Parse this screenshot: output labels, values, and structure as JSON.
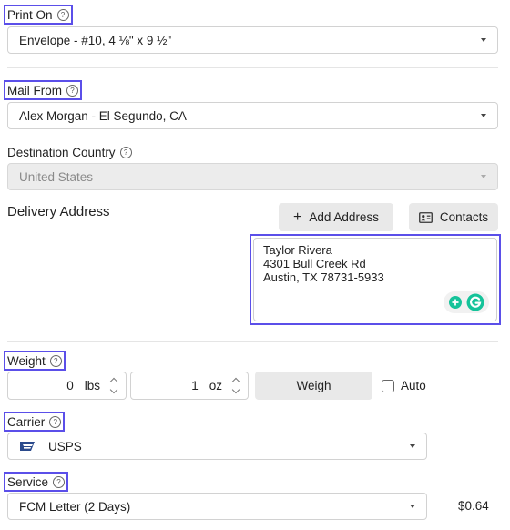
{
  "print_on": {
    "label": "Print On",
    "help": "?",
    "value": "Envelope - #10, 4 ⅛\" x 9 ½\""
  },
  "mail_from": {
    "label": "Mail From",
    "help": "?",
    "value": "Alex Morgan - El Segundo, CA"
  },
  "destination_country": {
    "label": "Destination Country",
    "help": "?",
    "value": "United States"
  },
  "delivery_address": {
    "label": "Delivery Address",
    "add_address_button": "Add Address",
    "contacts_button": "Contacts",
    "lines": [
      "Taylor Rivera",
      "4301 Bull Creek Rd",
      "Austin, TX 78731-5933"
    ]
  },
  "weight": {
    "label": "Weight",
    "help": "?",
    "lbs_value": "0",
    "lbs_unit": "lbs",
    "oz_value": "1",
    "oz_unit": "oz",
    "weigh_button": "Weigh",
    "auto_label": "Auto",
    "auto_checked": false
  },
  "carrier": {
    "label": "Carrier",
    "help": "?",
    "value": "USPS"
  },
  "service": {
    "label": "Service",
    "help": "?",
    "value": "FCM Letter (2 Days)",
    "price": "$0.64"
  },
  "colors": {
    "highlight": "#5b4fe9",
    "grammarly_green": "#15c39a"
  },
  "icons": [
    "help-icon",
    "dropdown-caret-icon",
    "plus-icon",
    "contacts-card-icon",
    "grammarly-icon",
    "usps-eagle-icon",
    "stepper-icon"
  ]
}
